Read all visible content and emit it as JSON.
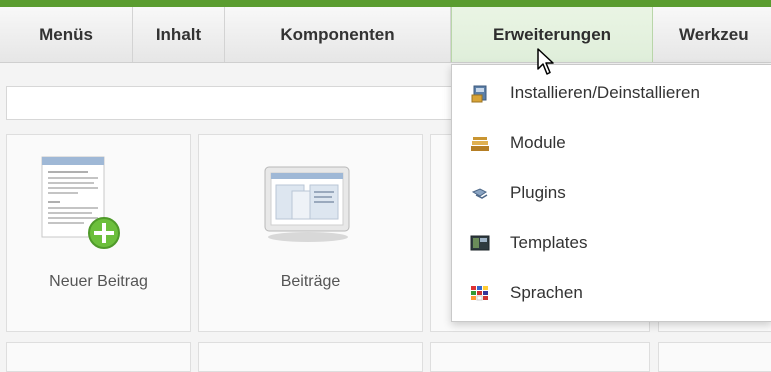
{
  "menubar": {
    "items": [
      {
        "label": "Menüs"
      },
      {
        "label": "Inhalt"
      },
      {
        "label": "Komponenten"
      },
      {
        "label": "Erweiterungen",
        "active": true
      },
      {
        "label": "Werkzeu"
      }
    ]
  },
  "panels": [
    {
      "label": "Neuer Beitrag",
      "icon": "new-article-icon"
    },
    {
      "label": "Beiträge",
      "icon": "articles-icon"
    }
  ],
  "dropdown": {
    "items": [
      {
        "label": "Installieren/Deinstallieren",
        "icon": "install-icon"
      },
      {
        "label": "Module",
        "icon": "module-icon"
      },
      {
        "label": "Plugins",
        "icon": "plugin-icon"
      },
      {
        "label": "Templates",
        "icon": "template-icon"
      },
      {
        "label": "Sprachen",
        "icon": "language-icon"
      }
    ]
  },
  "colors": {
    "accent": "#5a9c2f",
    "active_menu_bg": "#eaf5e4"
  }
}
